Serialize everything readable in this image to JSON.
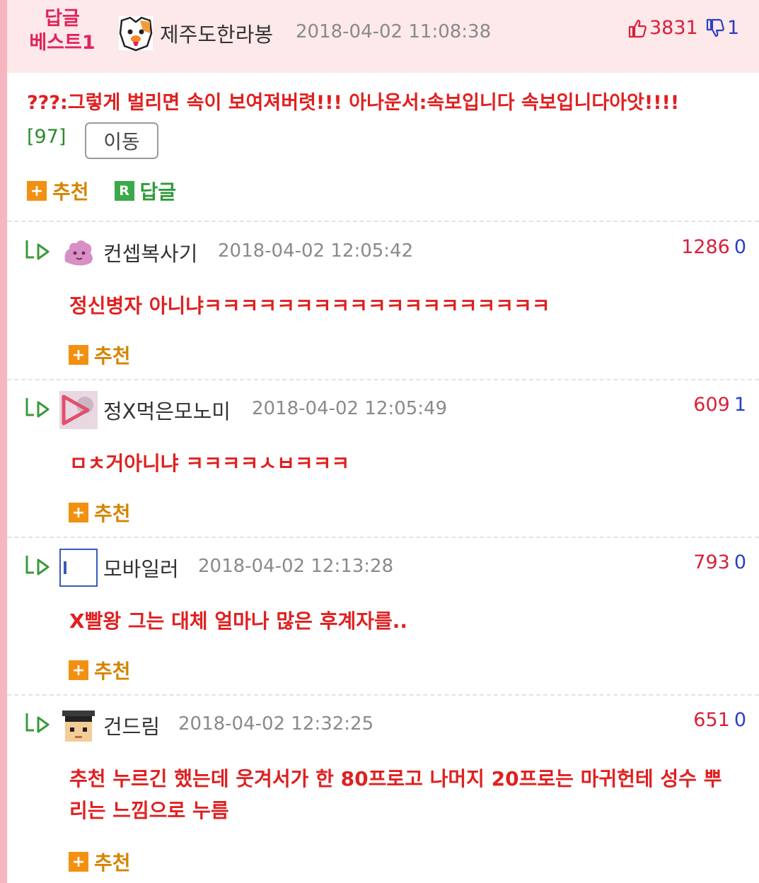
{
  "best": {
    "badge_line1": "답글",
    "badge_line2": "베스트1",
    "author": "제주도한라봉",
    "date": "2018-04-02 11:08:38",
    "upvotes": "3831",
    "downvotes": "1",
    "text": "???:그렇게 벌리면 속이 보여져버렷!!! 아나운서:속보입니다 속보입니다아앗!!!!",
    "count": "[97]",
    "move_label": "이동",
    "recommend_label": "추천",
    "reply_label": "답글"
  },
  "comments": [
    {
      "author": "컨셉복사기",
      "date": "2018-04-02 12:05:42",
      "up": "1286",
      "down": "0",
      "text": "정신병자 아니냐ㅋㅋㅋㅋㅋㅋㅋㅋㅋㅋㅋㅋㅋㅋㅋㅋㅋㅋㅋ",
      "recommend_label": "추천"
    },
    {
      "author": "정X먹은모노미",
      "date": "2018-04-02 12:05:49",
      "up": "609",
      "down": "1",
      "text": "ㅁㅊ거아니냐 ㅋㅋㅋㅋㅅㅂㅋㅋㅋ",
      "recommend_label": "추천"
    },
    {
      "author": "모바일러",
      "date": "2018-04-02 12:13:28",
      "up": "793",
      "down": "0",
      "text": "X빨왕 그는 대체 얼마나 많은 후계자를..",
      "recommend_label": "추천"
    },
    {
      "author": "건드림",
      "date": "2018-04-02 12:32:25",
      "up": "651",
      "down": "0",
      "text": "추천 누르긴 했는데 웃겨서가 한 80프로고 나머지 20프로는 마귀헌테 성수 뿌리는 느낌으로 누름",
      "recommend_label": "추천"
    }
  ],
  "colors": {
    "accent_red": "#e02020",
    "header_bg": "#fde8ea",
    "upvote": "#d8203a",
    "downvote": "#2a3fc4",
    "recommend": "#d68400",
    "reply_green": "#2f9a3a"
  },
  "icons": [
    "thumbs-up-icon",
    "thumbs-down-icon",
    "reply-arrow-icon",
    "plus-icon",
    "reply-r-icon"
  ]
}
